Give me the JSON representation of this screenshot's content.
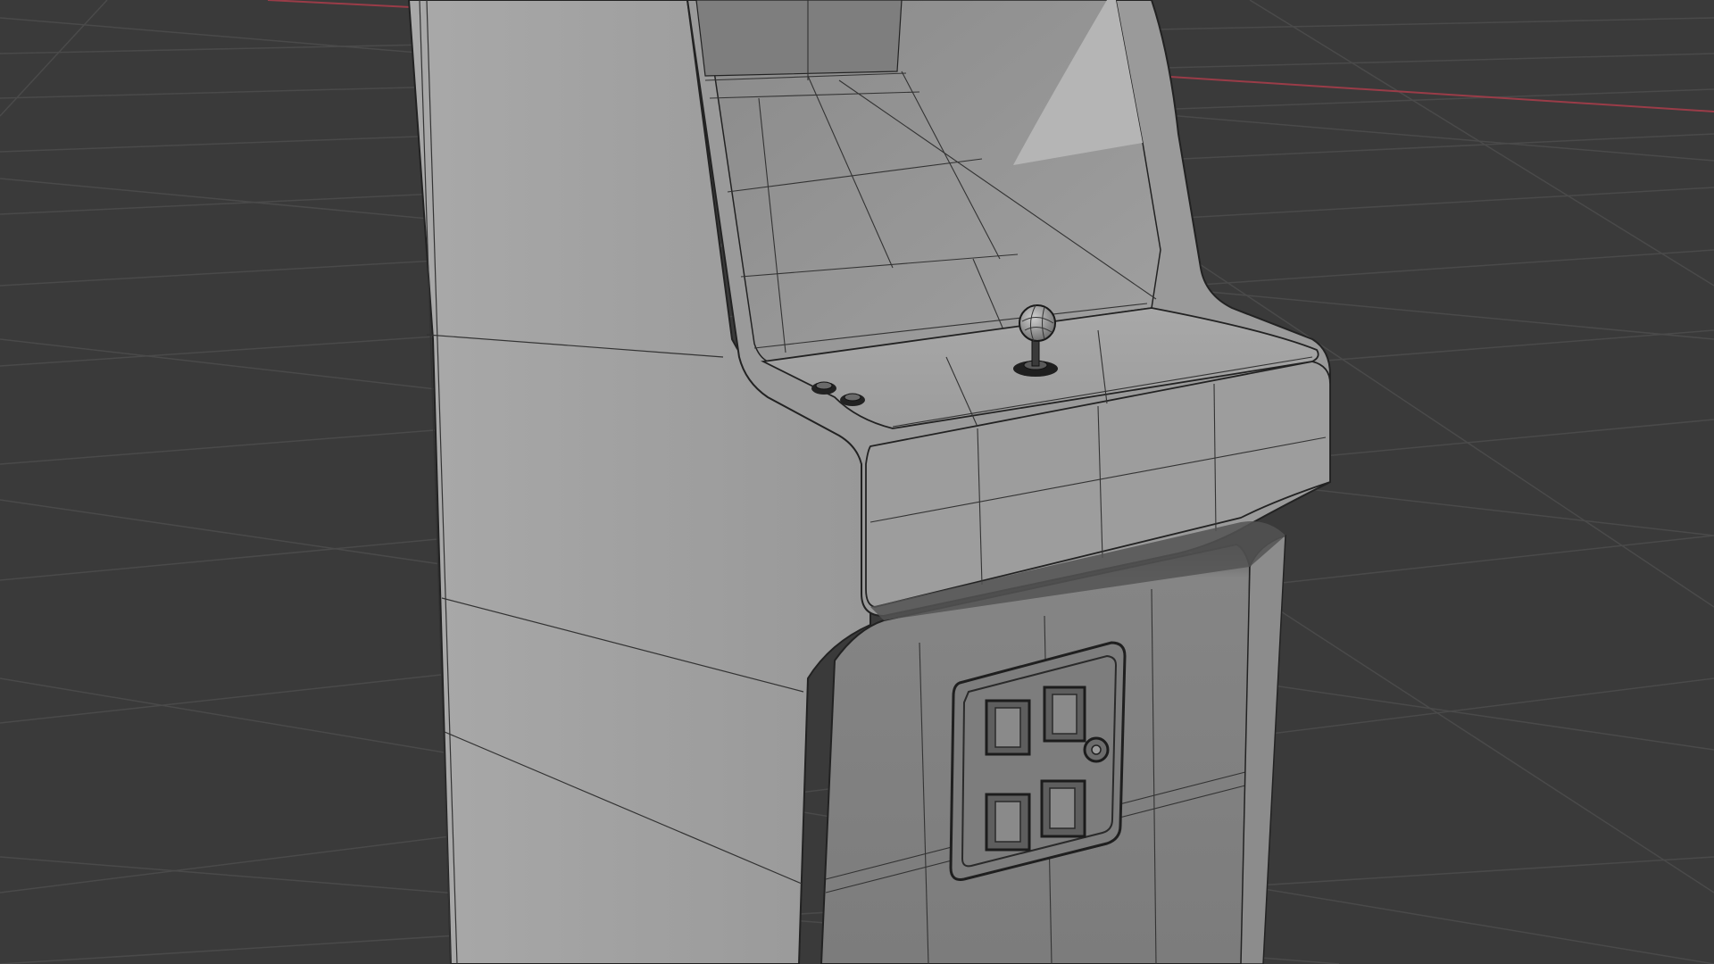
{
  "scene": {
    "subject": "arcade-cabinet",
    "view": "3d-viewport",
    "colors": {
      "background": "#3a3a3a",
      "grid_line": "#4b4b4b",
      "x_axis": "#9a3c48",
      "cabinet_side": "#a3a3a3",
      "cabinet_front": "#8e8e8e",
      "control_panel_top": "#a6a6a6",
      "control_panel_front": "#9a9a9a",
      "lower_front": "#848484",
      "wireframe_edge": "#222222",
      "coin_door": "#7d7d7d"
    },
    "icons": {
      "joystick": "joystick-icon",
      "buttons": "player-button-icon",
      "coin_slots": "coin-slot-icon"
    }
  }
}
